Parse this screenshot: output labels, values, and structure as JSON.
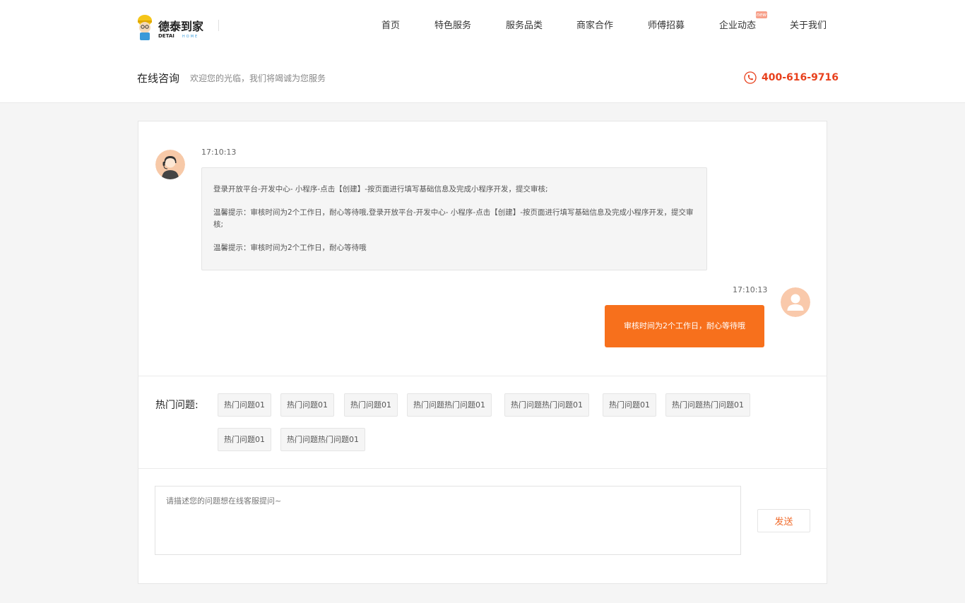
{
  "brand": {
    "name": "德泰到家",
    "sub_left": "DETAI",
    "sub_right": "HOME",
    "accent": "#f7701c",
    "phone_color": "#e8401c"
  },
  "nav": {
    "items": [
      "首页",
      "特色服务",
      "服务品类",
      "商家合作",
      "师傅招募",
      "企业动态",
      "关于我们"
    ],
    "badge": "new"
  },
  "consult": {
    "title": "在线咨询",
    "subtitle": "欢迎您的光临，我们将竭诚为您服务",
    "phone": "400-616-9716"
  },
  "chat": {
    "messages": [
      {
        "from": "agent",
        "time": "17:10:13",
        "paragraphs": [
          "登录开放平台-开发中心- 小程序-点击【创建】-按页面进行填写基础信息及完成小程序开发，提交审核;",
          "温馨提示：审核时间为2个工作日，耐心等待哦,登录开放平台-开发中心-   小程序-点击【创建】-按页面进行填写基础信息及完成小程序开发，提交审核;",
          "温馨提示：审核时间为2个工作日，耐心等待哦"
        ]
      },
      {
        "from": "user",
        "time": "17:10:13",
        "text": "审核时间为2个工作日，耐心等待哦"
      }
    ]
  },
  "hot": {
    "label": "热门问题:",
    "tags": [
      "热门问题01",
      "热门问题01",
      "热门问题01",
      "热门问题热门问题01",
      "热门问题热门问题01",
      "热门问题01",
      "热门问题热门问题01",
      "热门问题01",
      "热门问题热门问题01"
    ]
  },
  "composer": {
    "placeholder": "请描述您的问题想在线客服提问~",
    "value": "",
    "send_label": "发送"
  }
}
